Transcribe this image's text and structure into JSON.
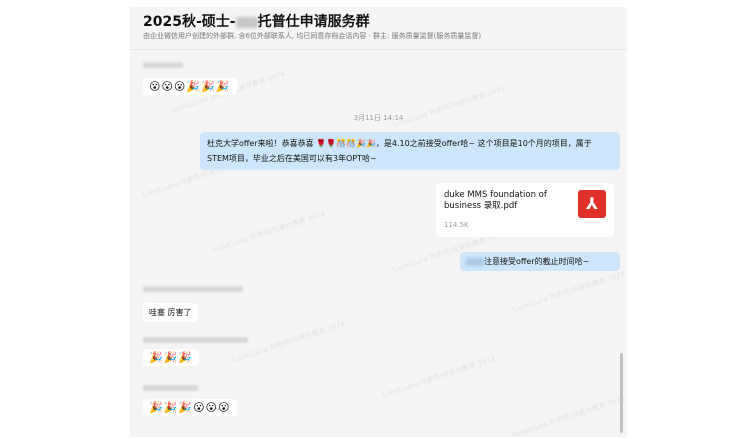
{
  "header": {
    "title_part1": "2025秋-硕士-",
    "title_part2": "托普仕申请服务群",
    "subtitle": "由企业微信用户创建的外部群, 含6位外部联系人, 均已同意存档会话内容 · 群主: 服务质量监督(服务质量监督)"
  },
  "messages": {
    "emoji1": "😮😮😮🎉🎉🎉",
    "time": "3月11日 14:14",
    "out_text": "杜克大学offer来啦！恭喜恭喜 🌹🌹🎊🎊🎉🎉，是4.10之前接受offer哈~ 这个项目是10个月的项目，属于STEM项目，毕业之后在美国可以有3年OPT哈~",
    "file_name": "duke  MMS foundation of business 录取.pdf",
    "file_size": "114.5K",
    "file_icon": "pdf-icon",
    "out_short": "注意接受offer的截止时间哈~",
    "reply": "哇塞 厉害了",
    "emoji2": "🎉🎉🎉",
    "emoji3": "🎉🎉🎉😮😮😮"
  },
  "watermark": "Luna(Luna 刘老师)托普仕教育 3974",
  "colors": {
    "out_bubble": "#cde6fb",
    "pdf": "#e0302c"
  }
}
